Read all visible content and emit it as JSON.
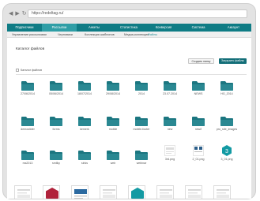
{
  "browser": {
    "url": "https://redeltag.ru/"
  },
  "topnav": {
    "items": [
      "Подписчики",
      "Рассылки",
      "Анкеты",
      "Статистика",
      "Конверсия",
      "Система",
      "Аккаунт"
    ],
    "active_index": 1
  },
  "subnav": {
    "items": [
      "Управление рассылками",
      "Черновики",
      "Коллекция шаблонов",
      "Медиа-коллекция",
      "Файлы"
    ],
    "active_index": 4
  },
  "page": {
    "title": "Каталог файлов",
    "breadcrumb": "Каталог файлов"
  },
  "toolbar": {
    "create_label": "Создать папку",
    "upload_label": "Загрузить файлы"
  },
  "folders": [
    {
      "label": "27/06/2014"
    },
    {
      "label": "05/06/2014"
    },
    {
      "label": "18/07/2014"
    },
    {
      "label": "29/08/2014"
    },
    {
      "label": "2014"
    },
    {
      "label": "23.07.2014"
    },
    {
      "label": "NEWS"
    },
    {
      "label": "HG_2014"
    },
    {
      "label": "demoslider"
    },
    {
      "label": "forms"
    },
    {
      "label": "kemerk"
    },
    {
      "label": "mobile"
    },
    {
      "label": "mobile-footer"
    },
    {
      "label": "new"
    },
    {
      "label": "new2"
    },
    {
      "label": "pro_site_images"
    },
    {
      "label": "rss2013"
    },
    {
      "label": "smilky"
    },
    {
      "label": "sinks"
    },
    {
      "label": "web"
    },
    {
      "label": "webinar"
    }
  ],
  "files": [
    {
      "label": "3rd.png"
    },
    {
      "label": "2_01.png"
    },
    {
      "label": "3_01.png"
    }
  ],
  "colors": {
    "accent": "#0f7c85",
    "folder": "#1b7680",
    "active_tab": "#2f9ea6",
    "upload_btn": "#136e78"
  }
}
